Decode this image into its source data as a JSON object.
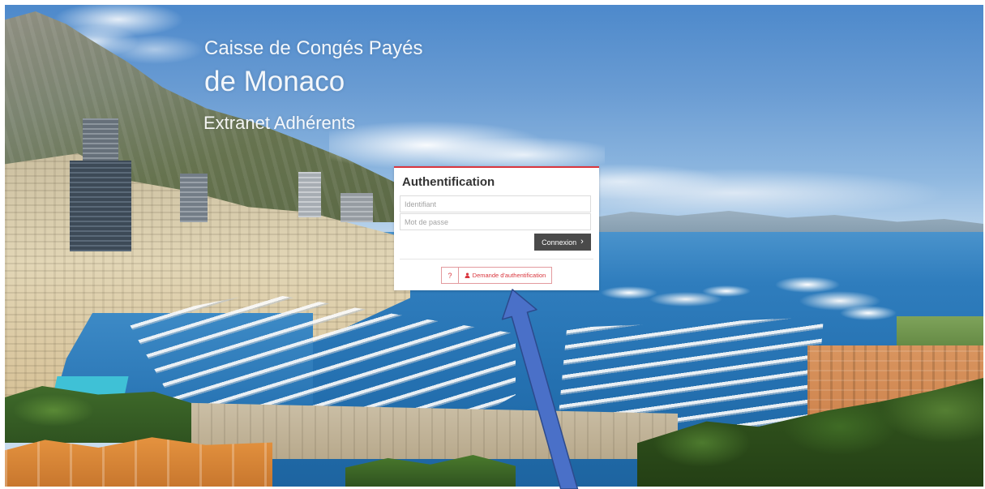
{
  "header": {
    "line1": "Caisse de Congés Payés",
    "line2": "de Monaco",
    "line3": "Extranet Adhérents"
  },
  "login": {
    "title": "Authentification",
    "username": {
      "placeholder": "Identifiant"
    },
    "password": {
      "placeholder": "Mot de passe"
    },
    "submit": {
      "label": "Connexion",
      "icon": "chevron-right-icon"
    },
    "help": {
      "label": "?"
    },
    "request_auth": {
      "label": "Demande d'authentification",
      "icon": "user-icon"
    }
  },
  "annotation": {
    "icon": "arrow-icon",
    "color": "#4a70c8"
  },
  "colors": {
    "accent": "#d9363e",
    "button_dark": "#4a4a4a",
    "text_dark": "#333333"
  }
}
